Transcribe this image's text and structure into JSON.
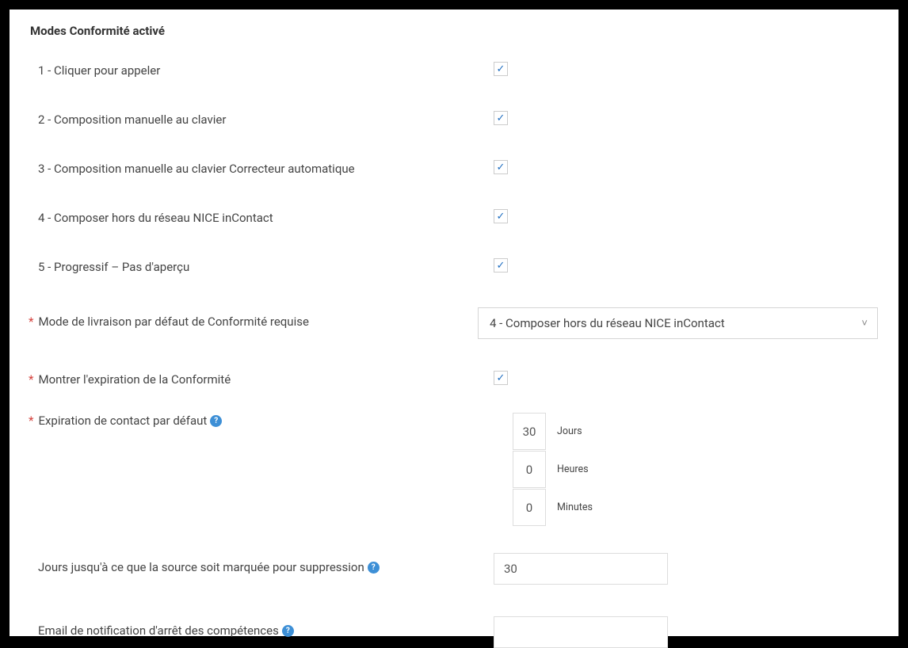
{
  "sectionTitle": "Modes Conformité activé",
  "modes": [
    {
      "label": "1 - Cliquer pour appeler",
      "checked": true
    },
    {
      "label": "2 - Composition manuelle au clavier",
      "checked": true
    },
    {
      "label": "3 - Composition manuelle au clavier Correcteur automatique",
      "checked": true
    },
    {
      "label": "4 - Composer hors du réseau NICE inContact",
      "checked": true
    },
    {
      "label": "5 - Progressif – Pas d'aperçu",
      "checked": true
    }
  ],
  "defaultDelivery": {
    "label": "Mode de livraison par défaut de Conformité requise",
    "selected": "4 - Composer hors du réseau NICE inContact"
  },
  "showExpiration": {
    "label": "Montrer l'expiration de la Conformité",
    "checked": true
  },
  "defaultExpiration": {
    "label": "Expiration de contact par défaut",
    "days": {
      "value": "30",
      "unit": "Jours"
    },
    "hours": {
      "value": "0",
      "unit": "Heures"
    },
    "minutes": {
      "value": "0",
      "unit": "Minutes"
    }
  },
  "daysUntilMarked": {
    "label": "Jours jusqu'à ce que la source soit marquée pour suppression",
    "value": "30"
  },
  "stopEmail": {
    "label": "Email de notification d'arrêt des compétences",
    "value": ""
  },
  "glyphs": {
    "check": "✓",
    "help": "?"
  }
}
